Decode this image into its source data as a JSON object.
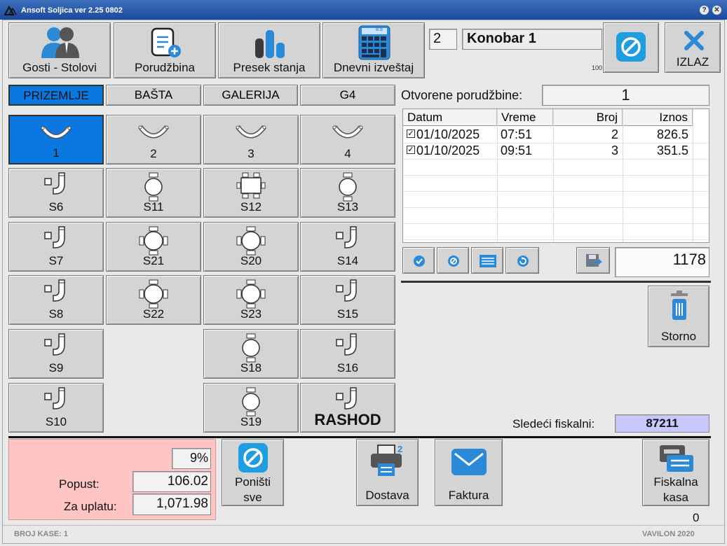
{
  "window": {
    "title": "Ansoft Soljica ver 2.25 0802"
  },
  "toolbar": {
    "guests_tables": "Gosti - Stolovi",
    "order": "Porudžbina",
    "stock_report": "Presek stanja",
    "daily_report": "Dnevni izveštaj",
    "calc_display": "8.9",
    "exit": "IZLAZ"
  },
  "waiter": {
    "number": "2",
    "name": "Konobar 1",
    "small_number": "100"
  },
  "tabs": [
    "PRIZEMLJE",
    "BAŠTA",
    "GALERIJA",
    "G4"
  ],
  "tables": [
    "1",
    "2",
    "3",
    "4",
    "S6",
    "S11",
    "S12",
    "S13",
    "S7",
    "S21",
    "S20",
    "S14",
    "S8",
    "S22",
    "S23",
    "S15",
    "S9",
    "S18",
    "S16",
    "S10",
    "S19",
    "RASHOD"
  ],
  "orders": {
    "label": "Otvorene porudžbine:",
    "count": "1",
    "columns": [
      "Datum",
      "Vreme",
      "Broj",
      "Iznos"
    ],
    "rows": [
      {
        "date": "01/10/2025",
        "time": "07:51",
        "number": "2",
        "amount": "826.5"
      },
      {
        "date": "01/10/2025",
        "time": "09:51",
        "number": "3",
        "amount": "351.5"
      }
    ],
    "total": "1178"
  },
  "storno": "Storno",
  "fiscal": {
    "label": "Sledeći fiskalni:",
    "value": "87211"
  },
  "payment": {
    "discount_pct": "9%",
    "discount_label": "Popust:",
    "discount_value": "106.02",
    "total_label": "Za uplatu:",
    "total_value": "1,071.98"
  },
  "actions": {
    "cancel_all": "Poništi sve",
    "delivery": "Dostava",
    "invoice": "Faktura",
    "fiscal_register": "Fiskalna kasa",
    "fiscal_count": "0"
  },
  "status": {
    "register": "BROJ KASE: 1",
    "brand": "VAVILON 2020"
  },
  "colors": {
    "accent": "#0a78e0",
    "payment_bg": "#ffc4c4",
    "fiscal_bg": "#c8c8ff",
    "titlebar": "#1d4a9a"
  }
}
